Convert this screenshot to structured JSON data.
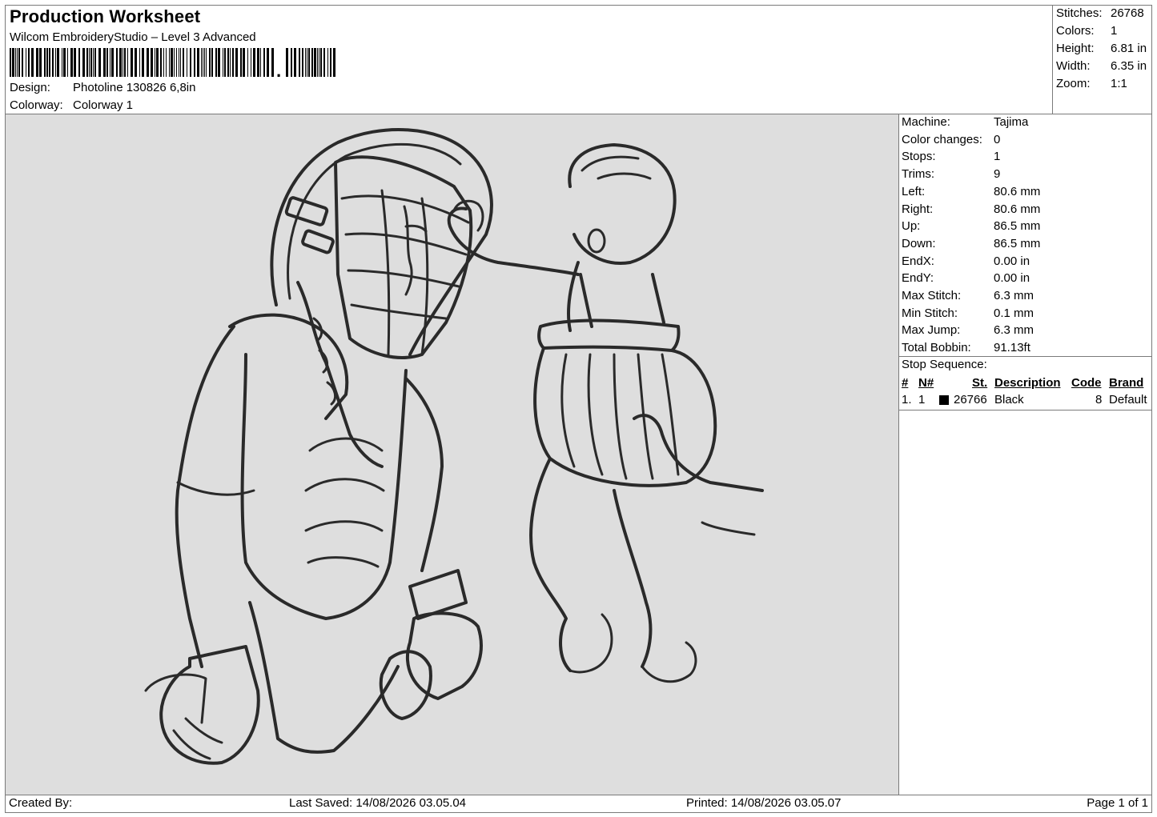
{
  "header": {
    "title": "Production Worksheet",
    "software": "Wilcom EmbroideryStudio – Level 3 Advanced",
    "barcode_label": "barcode",
    "design_label": "Design:",
    "design_value": "Photoline 130826 6,8in",
    "colorway_label": "Colorway:",
    "colorway_value": "Colorway 1"
  },
  "summary": {
    "stitches_label": "Stitches:",
    "stitches_value": "26768",
    "colors_label": "Colors:",
    "colors_value": "1",
    "height_label": "Height:",
    "height_value": "6.81 in",
    "width_label": "Width:",
    "width_value": "6.35 in",
    "zoom_label": "Zoom:",
    "zoom_value": "1:1"
  },
  "machine_info": [
    {
      "label": "Machine:",
      "value": "Tajima"
    },
    {
      "label": "Color changes:",
      "value": "0"
    },
    {
      "label": "Stops:",
      "value": "1"
    },
    {
      "label": "Trims:",
      "value": "9"
    },
    {
      "label": "Left:",
      "value": "80.6 mm"
    },
    {
      "label": "Right:",
      "value": "80.6 mm"
    },
    {
      "label": "Up:",
      "value": "86.5 mm"
    },
    {
      "label": "Down:",
      "value": "86.5 mm"
    },
    {
      "label": "EndX:",
      "value": "0.00 in"
    },
    {
      "label": "EndY:",
      "value": "0.00 in"
    },
    {
      "label": "Max Stitch:",
      "value": "6.3 mm"
    },
    {
      "label": "Min Stitch:",
      "value": "0.1 mm"
    },
    {
      "label": "Max Jump:",
      "value": "6.3 mm"
    },
    {
      "label": "Total Bobbin:",
      "value": "91.13ft"
    }
  ],
  "stop_sequence": {
    "title": "Stop Sequence:",
    "columns": [
      "#",
      "N#",
      "St.",
      "Description",
      "Code",
      "Brand"
    ],
    "rows": [
      {
        "num": "1.",
        "n": "1",
        "color": "#000000",
        "stitches": "26766",
        "description": "Black",
        "code": "8",
        "brand": "Default"
      }
    ]
  },
  "footer": {
    "created_by": "Created By:",
    "last_saved": "Last Saved: 14/08/2026 03.05.04",
    "printed": "Printed: 14/08/2026 03.05.07",
    "page": "Page 1 of 1"
  },
  "canvas": {
    "background": "#dedede",
    "thread_color": "#2a2a2a",
    "subject": "catcher-holding-baby-line-art"
  }
}
